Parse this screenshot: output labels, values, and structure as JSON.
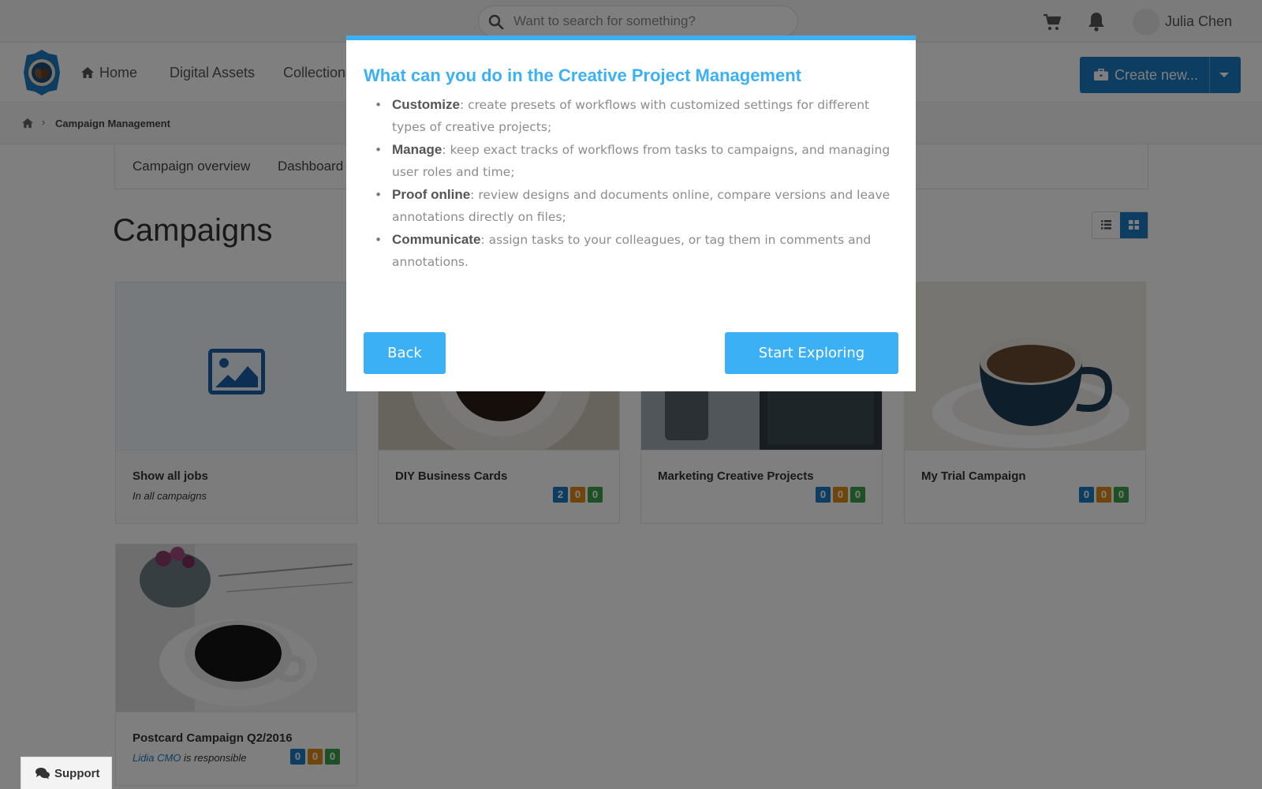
{
  "topbar": {
    "search_placeholder": "Want to search for something?",
    "user_name": "Julia Chen"
  },
  "nav": {
    "home": "Home",
    "digital_assets": "Digital Assets",
    "collections": "Collections",
    "create_new": "Create new..."
  },
  "breadcrumb": {
    "separator": "›",
    "current": "Campaign Management"
  },
  "subnav": {
    "overview": "Campaign overview",
    "dashboard": "Dashboard"
  },
  "page": {
    "title": "Campaigns"
  },
  "cards": [
    {
      "title": "Show all jobs",
      "subtitle": "In all campaigns"
    },
    {
      "title": "DIY Business Cards",
      "badges": [
        "2",
        "0",
        "0"
      ]
    },
    {
      "title": "Marketing Creative Projects",
      "badges": [
        "0",
        "0",
        "0"
      ]
    },
    {
      "title": "My Trial Campaign",
      "badges": [
        "0",
        "0",
        "0"
      ]
    },
    {
      "title": "Postcard Campaign Q2/2016",
      "responsible_name": "Lidia CMO",
      "responsible_suffix": " is responsible",
      "badges": [
        "0",
        "0",
        "0"
      ]
    }
  ],
  "support": {
    "label": "Support"
  },
  "modal": {
    "title": "What can you do in the Creative Project Management",
    "features": [
      {
        "term": "Customize",
        "text": ": create presets of workflows with customized settings for different types of creative projects;"
      },
      {
        "term": "Manage",
        "text": ": keep exact tracks of workflows from tasks to campaigns, and managing user roles and time;"
      },
      {
        "term": "Proof online",
        "text": ": review designs and documents online, compare versions and leave annotations directly on files;"
      },
      {
        "term": "Communicate",
        "text": ": assign tasks to your colleagues, or tag them in comments and annotations."
      }
    ],
    "back_label": "Back",
    "start_label": "Start Exploring"
  },
  "colors": {
    "accent_blue": "#1a7bc3",
    "modal_blue": "#3cb0f5",
    "badge_orange": "#e08a17",
    "badge_green": "#3aa34a"
  },
  "icons": [
    "search-icon",
    "cart-icon",
    "bell-icon",
    "home-icon",
    "briefcase-icon",
    "list-view-icon",
    "grid-view-icon",
    "image-placeholder-icon",
    "chat-icon"
  ]
}
